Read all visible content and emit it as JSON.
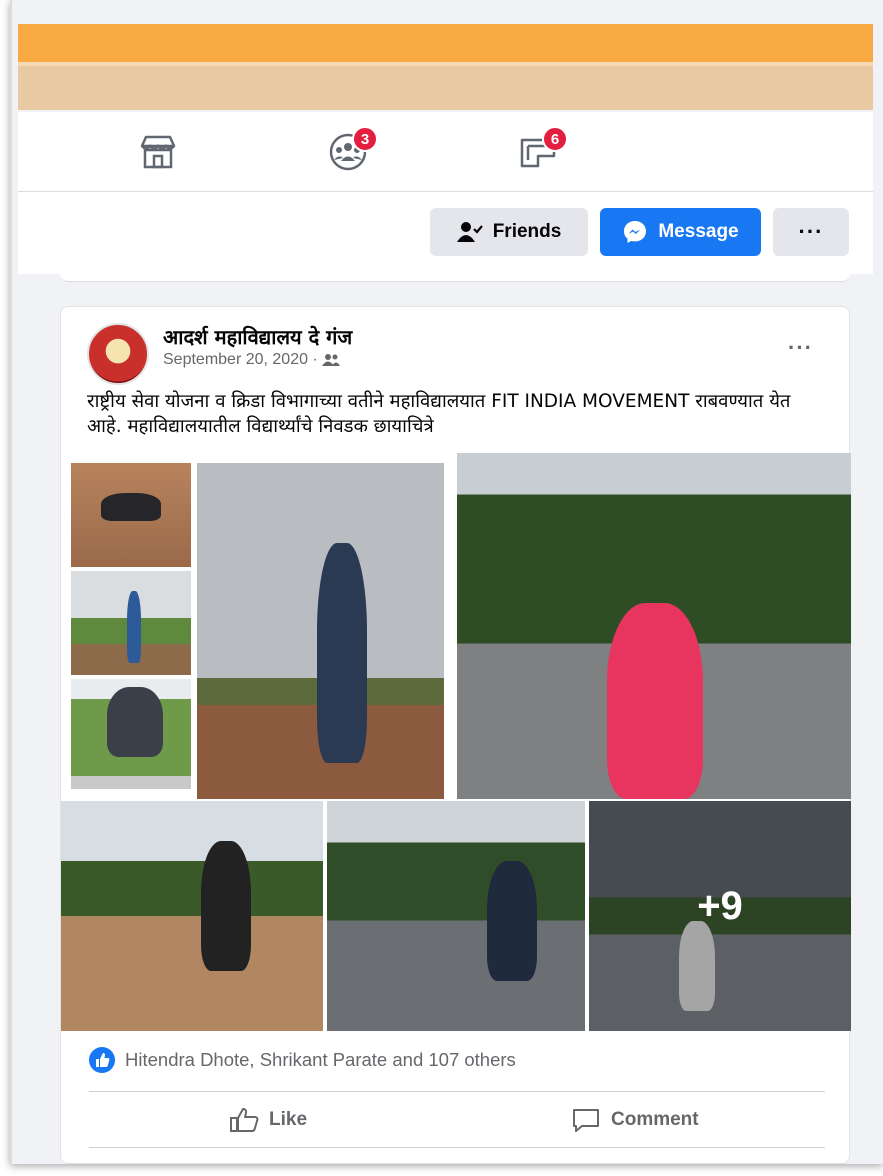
{
  "header": {
    "icons": [
      {
        "name": "marketplace-icon",
        "badge": ""
      },
      {
        "name": "groups-icon",
        "badge": "3"
      },
      {
        "name": "gaming-icon",
        "badge": "6"
      }
    ]
  },
  "profile_actions": {
    "friends_label": "Friends",
    "message_label": "Message",
    "more_label": "···"
  },
  "post": {
    "author": "आदर्श महाविद्यालय दे गंज",
    "date": "September 20, 2020 ·",
    "audience_icon": "friends-audience-icon",
    "more_label": "···",
    "text": "राष्ट्रीय सेवा योजना व क्रिडा विभागाच्या वतीने महाविद्यालयात FIT INDIA MOVEMENT राबवण्यात येत आहे.  महाविद्यालयातील विद्यार्थ्यांचे निवडक छायाचित्रे",
    "photos_more": "+9",
    "reactions": "Hitendra Dhote, Shrikant Parate and 107 others",
    "like_label": "Like",
    "comment_label": "Comment"
  },
  "colors": {
    "cover_orange": "#f9a942",
    "cover_tan": "#e8c9a2",
    "facebook_blue": "#1877f2",
    "badge_red": "#e41e3f"
  }
}
